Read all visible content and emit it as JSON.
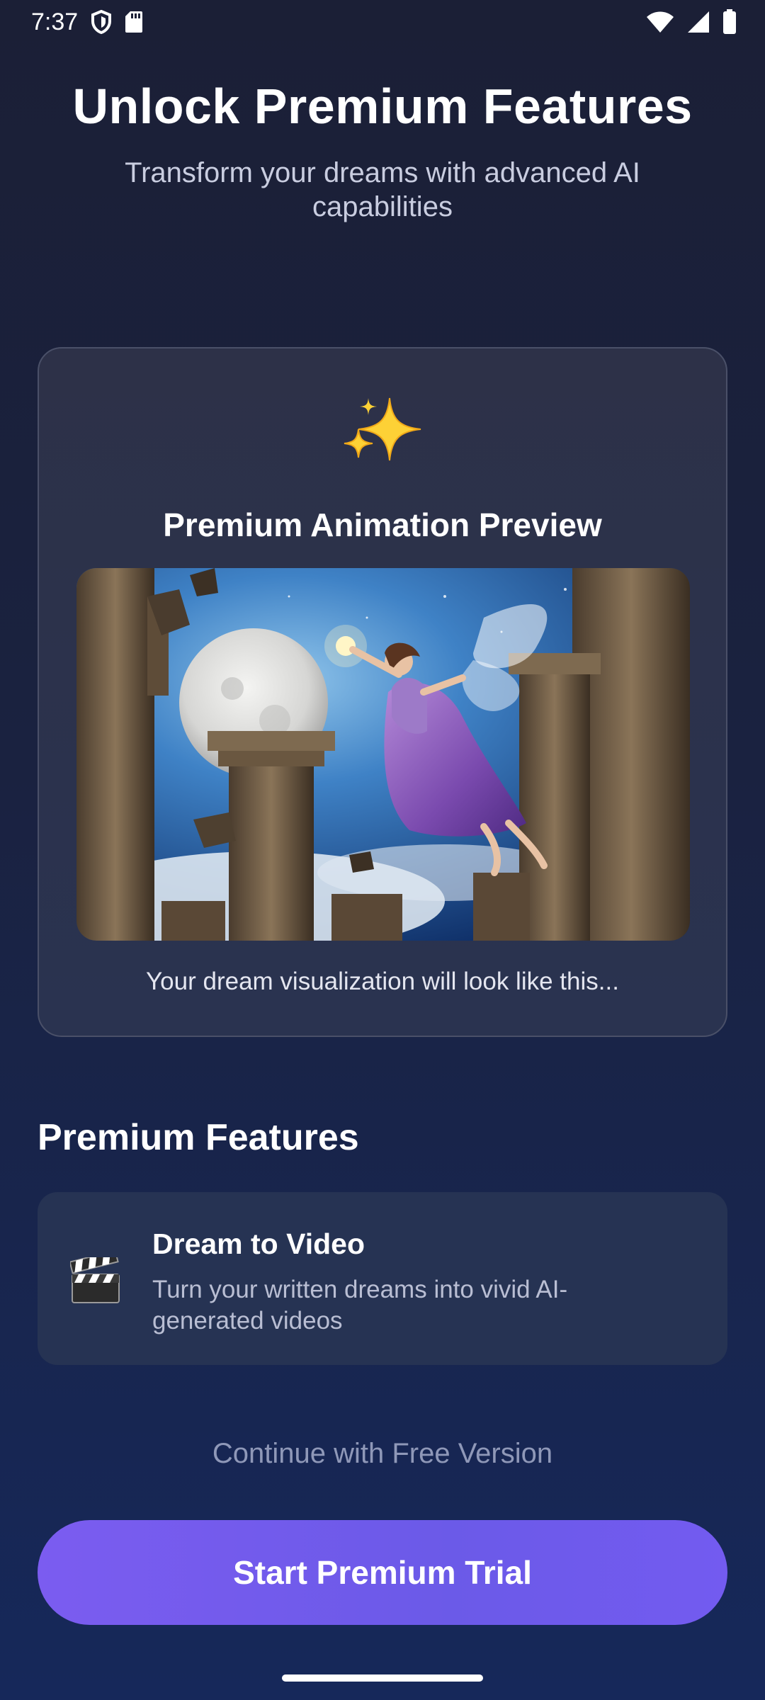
{
  "status_bar": {
    "time": "7:37",
    "icons_left": [
      "shield-icon",
      "sd-card-icon"
    ],
    "icons_right": [
      "wifi-icon",
      "signal-icon",
      "battery-icon"
    ]
  },
  "header": {
    "title": "Unlock Premium Features",
    "subtitle": "Transform your dreams with advanced AI capabilities"
  },
  "preview": {
    "icon": "sparkles-icon",
    "title": "Premium Animation Preview",
    "image": "fairy-moon-ruins-image",
    "caption": "Your dream visualization will look like this..."
  },
  "features": {
    "section_title": "Premium Features",
    "items": [
      {
        "icon": "clapperboard-icon",
        "title": "Dream to Video",
        "description": "Turn your written dreams into vivid AI-generated videos"
      }
    ]
  },
  "actions": {
    "free_label": "Continue with Free Version",
    "premium_label": "Start Premium Trial"
  },
  "colors": {
    "background_top": "#1b1f36",
    "background_bottom": "#16285a",
    "card": "#2d3148",
    "feature_card": "#263353",
    "accent": "#7b5cf0",
    "muted_text": "#8f98b8"
  }
}
